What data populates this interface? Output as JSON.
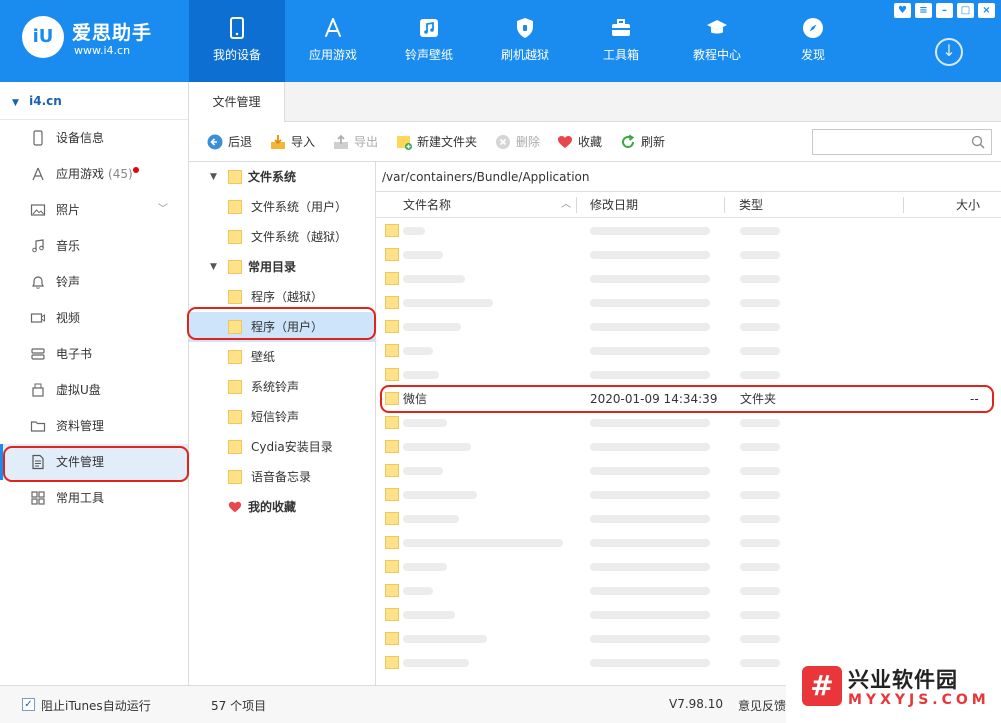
{
  "app": {
    "logo_badge": "iU",
    "logo_name": "爱思助手",
    "logo_url": "www.i4.cn"
  },
  "nav": [
    {
      "label": "我的设备",
      "icon": "phone-icon"
    },
    {
      "label": "应用游戏",
      "icon": "app-store-icon"
    },
    {
      "label": "铃声壁纸",
      "icon": "music-icon"
    },
    {
      "label": "刷机越狱",
      "icon": "shield-icon"
    },
    {
      "label": "工具箱",
      "icon": "toolbox-icon"
    },
    {
      "label": "教程中心",
      "icon": "graduation-cap-icon"
    },
    {
      "label": "发现",
      "icon": "compass-icon"
    }
  ],
  "sidebar": {
    "device": "i4.cn",
    "items": [
      {
        "label": "设备信息",
        "icon": "device-icon"
      },
      {
        "label": "应用游戏",
        "count": "(45)",
        "icon": "app-icon"
      },
      {
        "label": "照片",
        "icon": "photo-icon"
      },
      {
        "label": "音乐",
        "icon": "music-note-icon"
      },
      {
        "label": "铃声",
        "icon": "bell-icon"
      },
      {
        "label": "视频",
        "icon": "video-icon"
      },
      {
        "label": "电子书",
        "icon": "book-icon"
      },
      {
        "label": "虚拟U盘",
        "icon": "usb-icon"
      },
      {
        "label": "资料管理",
        "icon": "folder-icon"
      },
      {
        "label": "文件管理",
        "icon": "file-icon"
      },
      {
        "label": "常用工具",
        "icon": "grid-icon"
      }
    ]
  },
  "tab": {
    "label": "文件管理"
  },
  "toolbar": {
    "back": "后退",
    "import": "导入",
    "export": "导出",
    "new_folder": "新建文件夹",
    "delete": "删除",
    "favorite": "收藏",
    "refresh": "刷新",
    "search_placeholder": ""
  },
  "tree": [
    {
      "label": "文件系统",
      "bold": true,
      "caret": true
    },
    {
      "label": "文件系统（用户）"
    },
    {
      "label": "文件系统（越狱）"
    },
    {
      "label": "常用目录",
      "bold": true,
      "caret": true
    },
    {
      "label": "程序（越狱）"
    },
    {
      "label": "程序（用户）",
      "selected": true
    },
    {
      "label": "壁纸"
    },
    {
      "label": "系统铃声"
    },
    {
      "label": "短信铃声"
    },
    {
      "label": "Cydia安装目录"
    },
    {
      "label": "语音备忘录"
    },
    {
      "label": "我的收藏",
      "bold": true,
      "heart": true
    }
  ],
  "path": "/var/containers/Bundle/Application",
  "columns": {
    "name": "文件名称",
    "date": "修改日期",
    "type": "类型",
    "size": "大小"
  },
  "file_row": {
    "name": "微信",
    "date": "2020-01-09 14:34:39",
    "type": "文件夹",
    "size": "--"
  },
  "status": {
    "itunes_checkbox": "阻止iTunes自动运行",
    "count": "57 个项目",
    "version": "V7.98.10",
    "feedback": "意见反馈"
  },
  "watermark": {
    "line1": "兴业软件园",
    "line2": "MYXYJS.COM",
    "mark": "#"
  },
  "colors": {
    "brand": "#1a8cf0",
    "highlight_ring": "#e2231a",
    "folder": "#ffe189"
  }
}
